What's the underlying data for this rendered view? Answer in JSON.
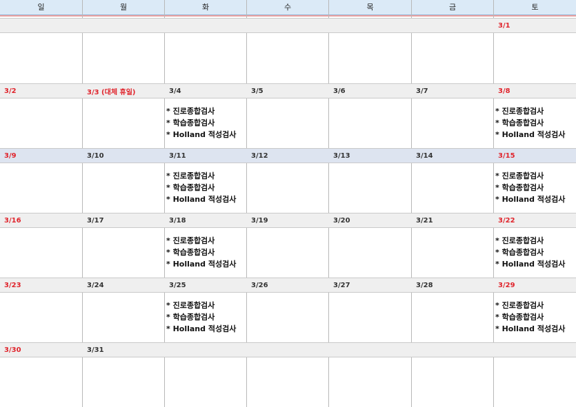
{
  "weekdays": [
    "일",
    "월",
    "화",
    "수",
    "목",
    "금",
    "토"
  ],
  "colors": {
    "header_bg": "#dbeaf7",
    "date_band": "#efefef",
    "date_band_alt": "#dde4f0",
    "holiday_red": "#e0242c"
  },
  "event_lines": [
    "* 진로종합검사",
    "* 학습종합검사",
    "* Holland 적성검사"
  ],
  "weeks": [
    {
      "dates": [
        "",
        "",
        "",
        "",
        "",
        "",
        "3/1"
      ],
      "events_cols": []
    },
    {
      "dates": [
        "3/2",
        "3/3 (대체 휴일)",
        "3/4",
        "3/5",
        "3/6",
        "3/7",
        "3/8"
      ],
      "events_cols": [
        2,
        6
      ]
    },
    {
      "dates": [
        "3/9",
        "3/10",
        "3/11",
        "3/12",
        "3/13",
        "3/14",
        "3/15"
      ],
      "events_cols": [
        2,
        6
      ]
    },
    {
      "dates": [
        "3/16",
        "3/17",
        "3/18",
        "3/19",
        "3/20",
        "3/21",
        "3/22"
      ],
      "events_cols": [
        2,
        6
      ]
    },
    {
      "dates": [
        "3/23",
        "3/24",
        "3/25",
        "3/26",
        "3/27",
        "3/28",
        "3/29"
      ],
      "events_cols": [
        2,
        6
      ]
    },
    {
      "dates": [
        "3/30",
        "3/31",
        "",
        "",
        "",
        "",
        ""
      ],
      "events_cols": []
    }
  ]
}
